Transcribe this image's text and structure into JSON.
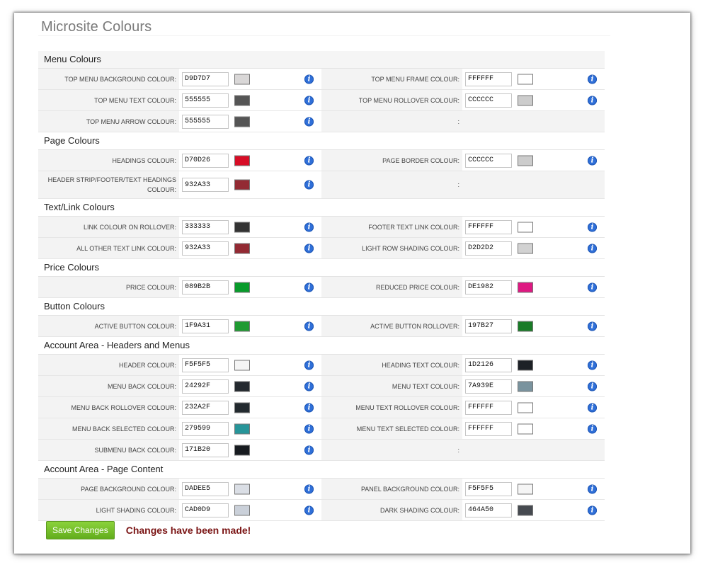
{
  "page_title": "Microsite Colours",
  "info_glyph": "i",
  "sections": [
    {
      "title": "Menu Colours",
      "rows": [
        [
          {
            "label": "TOP MENU BACKGROUND COLOUR:",
            "value": "D9D7D7",
            "swatch": "#D9D7D7"
          },
          {
            "label": "TOP MENU FRAME COLOUR:",
            "value": "FFFFFF",
            "swatch": "#FFFFFF"
          }
        ],
        [
          {
            "label": "TOP MENU TEXT COLOUR:",
            "value": "555555",
            "swatch": "#555555"
          },
          {
            "label": "TOP MENU ROLLOVER COLOUR:",
            "value": "CCCCCC",
            "swatch": "#CCCCCC"
          }
        ],
        [
          {
            "label": "TOP MENU ARROW COLOUR:",
            "value": "555555",
            "swatch": "#555555"
          },
          {
            "label": ":",
            "empty": true
          }
        ]
      ]
    },
    {
      "title": "Page Colours",
      "rows": [
        [
          {
            "label": "HEADINGS COLOUR:",
            "value": "D70D26",
            "swatch": "#D70D26"
          },
          {
            "label": "PAGE BORDER COLOUR:",
            "value": "CCCCCC",
            "swatch": "#CCCCCC"
          }
        ],
        [
          {
            "label": "HEADER STRIP/FOOTER/TEXT HEADINGS COLOUR:",
            "value": "932A33",
            "swatch": "#932A33",
            "tall": true
          },
          {
            "label": ":",
            "empty": true
          }
        ]
      ]
    },
    {
      "title": "Text/Link Colours",
      "rows": [
        [
          {
            "label": "LINK COLOUR ON ROLLOVER:",
            "value": "333333",
            "swatch": "#333333"
          },
          {
            "label": "FOOTER TEXT LINK COLOUR:",
            "value": "FFFFFF",
            "swatch": "#FFFFFF"
          }
        ],
        [
          {
            "label": "ALL OTHER TEXT LINK COLOUR:",
            "value": "932A33",
            "swatch": "#932A33"
          },
          {
            "label": "LIGHT ROW SHADING COLOUR:",
            "value": "D2D2D2",
            "swatch": "#D2D2D2"
          }
        ]
      ]
    },
    {
      "title": "Price Colours",
      "rows": [
        [
          {
            "label": "PRICE COLOUR:",
            "value": "089B2B",
            "swatch": "#089B2B"
          },
          {
            "label": "REDUCED PRICE COLOUR:",
            "value": "DE1982",
            "swatch": "#DE1982"
          }
        ]
      ]
    },
    {
      "title": "Button Colours",
      "rows": [
        [
          {
            "label": "ACTIVE BUTTON COLOUR:",
            "value": "1F9A31",
            "swatch": "#1F9A31"
          },
          {
            "label": "ACTIVE BUTTON ROLLOVER:",
            "value": "197B27",
            "swatch": "#197B27"
          }
        ]
      ]
    },
    {
      "title": "Account Area - Headers and Menus",
      "rows": [
        [
          {
            "label": "HEADER COLOUR:",
            "value": "F5F5F5",
            "swatch": "#F5F5F5"
          },
          {
            "label": "HEADING TEXT COLOUR:",
            "value": "1D2126",
            "swatch": "#1D2126"
          }
        ],
        [
          {
            "label": "MENU BACK COLOUR:",
            "value": "24292F",
            "swatch": "#24292F"
          },
          {
            "label": "MENU TEXT COLOUR:",
            "value": "7A939E",
            "swatch": "#7A939E"
          }
        ],
        [
          {
            "label": "MENU BACK ROLLOVER COLOUR:",
            "value": "232A2F",
            "swatch": "#232A2F"
          },
          {
            "label": "MENU TEXT ROLLOVER COLOUR:",
            "value": "FFFFFF",
            "swatch": "#FFFFFF"
          }
        ],
        [
          {
            "label": "MENU BACK SELECTED COLOUR:",
            "value": "279599",
            "swatch": "#279599"
          },
          {
            "label": "MENU TEXT SELECTED COLOUR:",
            "value": "FFFFFF",
            "swatch": "#FFFFFF"
          }
        ],
        [
          {
            "label": "SUBMENU BACK COLOUR:",
            "value": "171B20",
            "swatch": "#171B20"
          },
          {
            "label": ":",
            "empty": true
          }
        ]
      ]
    },
    {
      "title": "Account Area - Page Content",
      "rows": [
        [
          {
            "label": "PAGE BACKGROUND COLOUR:",
            "value": "DADEE5",
            "swatch": "#DADEE5"
          },
          {
            "label": "PANEL BACKGROUND COLOUR:",
            "value": "F5F5F5",
            "swatch": "#F5F5F5"
          }
        ],
        [
          {
            "label": "LIGHT SHADING COLOUR:",
            "value": "CAD0D9",
            "swatch": "#CAD0D9"
          },
          {
            "label": "DARK SHADING COLOUR:",
            "value": "464A50",
            "swatch": "#464A50"
          }
        ]
      ]
    }
  ],
  "footer": {
    "save_label": "Save Changes",
    "status_text": "Changes have been made!"
  }
}
